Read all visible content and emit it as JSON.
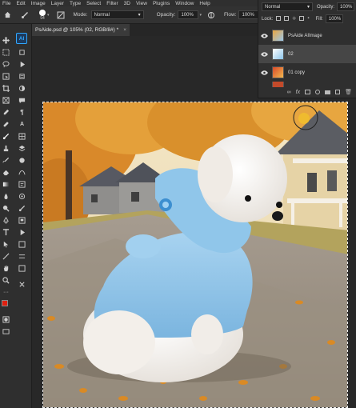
{
  "menu": [
    "File",
    "Edit",
    "Image",
    "Layer",
    "Type",
    "Select",
    "Filter",
    "3D",
    "View",
    "Plugins",
    "Window",
    "Help"
  ],
  "options": {
    "brush_size": "94",
    "mode_label": "Mode:",
    "mode_value": "Normal",
    "opacity_label": "Opacity:",
    "opacity_value": "100%",
    "flow_label": "Flow:",
    "flow_value": "100%"
  },
  "document_tab": {
    "title": "PsAide.psd @ 105% (02, RGB/8#) *",
    "close": "×"
  },
  "toolbar": {
    "badge": "AI"
  },
  "layers": {
    "blend_mode": "Normal",
    "opacity_label": "Opacity:",
    "opacity_value": "100%",
    "lock_label": "Lock:",
    "fill_label": "Fill:",
    "fill_value": "100%",
    "items": [
      {
        "name": "PsAide AIImage",
        "visible": true,
        "selected": false
      },
      {
        "name": "02",
        "visible": true,
        "selected": true
      },
      {
        "name": "01 copy",
        "visible": true,
        "selected": false
      }
    ],
    "footer_fx": "fx"
  },
  "colors": {
    "accent": "#31a8ff",
    "foreground": "#e02010",
    "background": "#000000",
    "hoodie": "#8cc5ea"
  }
}
